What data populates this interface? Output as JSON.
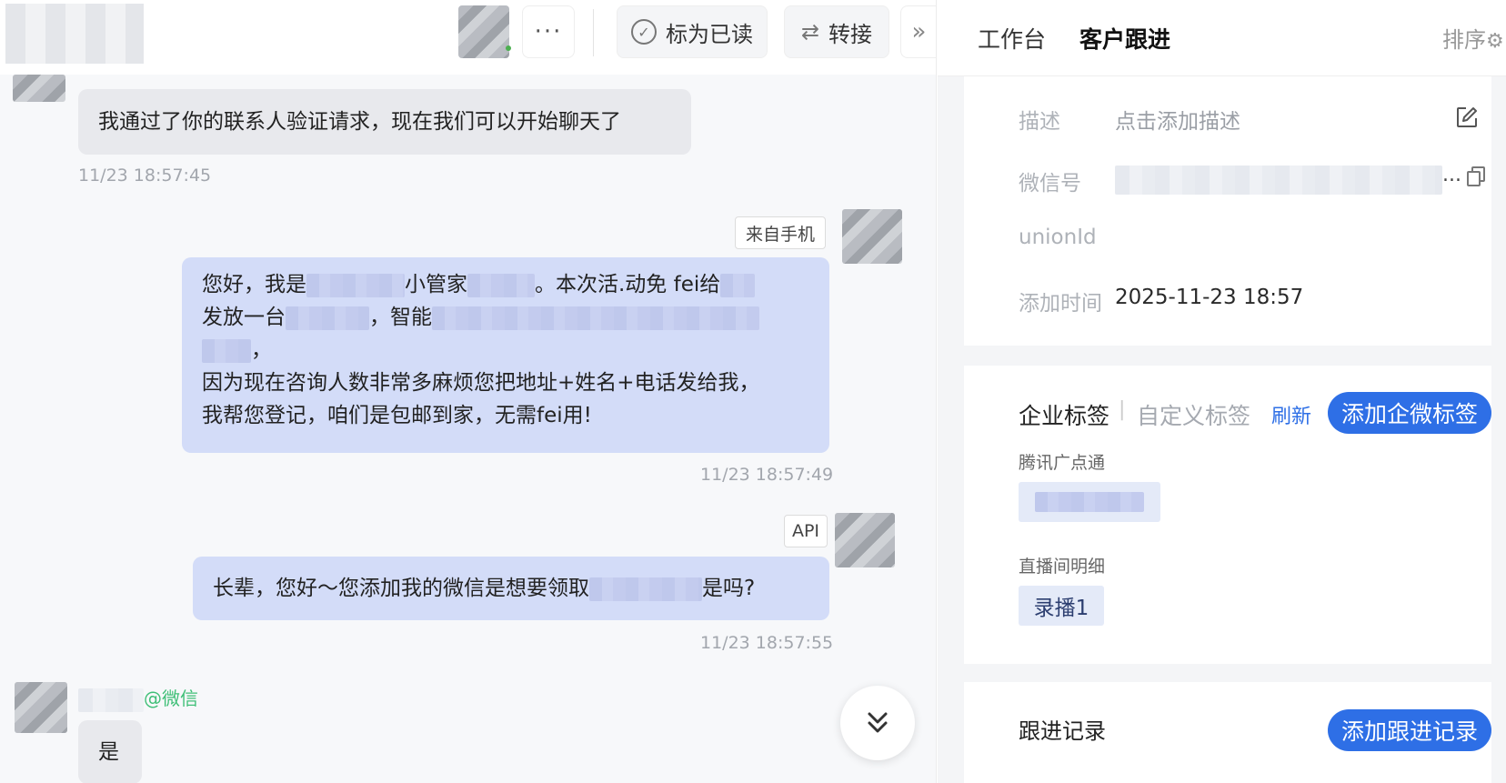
{
  "chat": {
    "header": {
      "more_label": "···",
      "mark_read_label": "标为已读",
      "transfer_label": "转接",
      "collapse_label": "»"
    },
    "messages": [
      {
        "text": "我通过了你的联系人验证请求，现在我们可以开始聊天了",
        "time": "11/23 18:57:45"
      },
      {
        "source": "来自手机",
        "line1_a": "您好，我是",
        "line1_b": "小管家",
        "line1_c": "。本次活.动免 fei给",
        "line2_a": "发放一台",
        "line2_b": "，智能",
        "line3_a": "，",
        "line4": "因为现在咨询人数非常多麻烦您把地址+姓名+电话发给我，",
        "line5": "我帮您登记，咱们是包邮到家，无需fei用!",
        "time": "11/23 18:57:49"
      },
      {
        "source": "API",
        "text_a": "长辈，您好～您添加我的微信是想要领取",
        "text_b": "是吗?",
        "time": "11/23 18:57:55"
      },
      {
        "sender_suffix": "@微信",
        "text": "是"
      }
    ]
  },
  "panel": {
    "tabs": [
      "工作台",
      "客户跟进"
    ],
    "sort_label": "排序",
    "info": {
      "desc_label": "描述",
      "desc_placeholder": "点击添加描述",
      "wechat_label": "微信号",
      "wechat_ellipsis": "...",
      "unionid_label": "unionId",
      "added_label": "添加时间",
      "added_value": "2025-11-23 18:57"
    },
    "tags": {
      "tab_enterprise": "企业标签",
      "separator": "|",
      "tab_custom": "自定义标签",
      "refresh": "刷新",
      "add_button": "添加企微标签",
      "group1_label": "腾讯广点通",
      "group2_label": "直播间明细",
      "group2_chip": "录播1"
    },
    "records": {
      "title": "跟进记录",
      "add_button": "添加跟进记录"
    }
  },
  "colors": {
    "accent": "#2e6fe6",
    "bubble_out": "#d3dcf8",
    "bubble_in": "#e8e9ed",
    "wechat_green": "#3fbf77"
  }
}
